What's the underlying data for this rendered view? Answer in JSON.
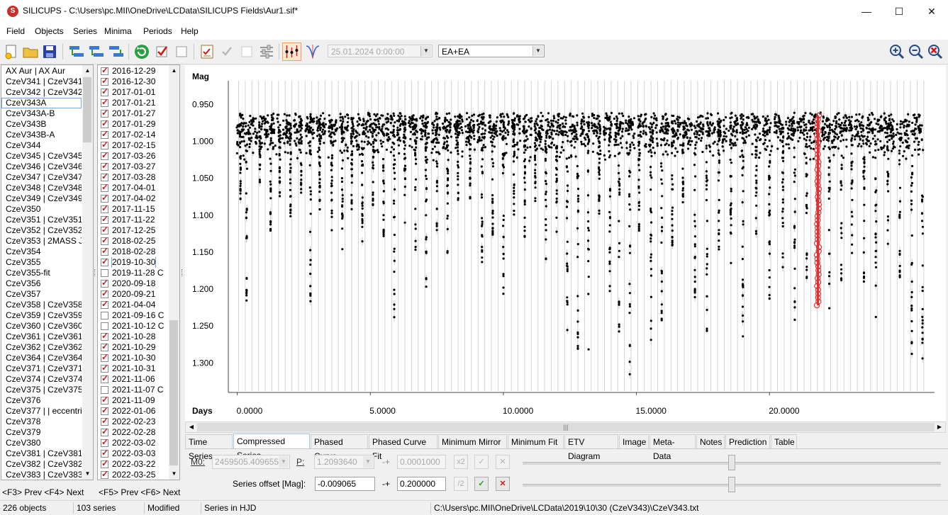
{
  "window": {
    "title": "SILICUPS - C:\\Users\\pc.MII\\OneDrive\\LCData\\SILICUPS Fields\\Aur1.sif*"
  },
  "menu": [
    "Field",
    "Objects",
    "Series",
    "Minima",
    "Periods",
    "Help"
  ],
  "toolbar": {
    "date_value": "25.01.2024   0:00:00",
    "filter_value": "EA+EA"
  },
  "objects": {
    "items": [
      "AX Aur | AX Aur",
      "CzeV341 | CzeV341",
      "CzeV342 | CzeV342",
      "CzeV343A",
      "CzeV343A-B",
      "CzeV343B",
      "CzeV343B-A",
      "CzeV344",
      "CzeV345 | CzeV345",
      "CzeV346 | CzeV346 |",
      "CzeV347 | CzeV347",
      "CzeV348 | CzeV348",
      "CzeV349 | CzeV349",
      "CzeV350",
      "CzeV351 | CzeV351",
      "CzeV352 | CzeV352",
      "CzeV353 | 2MASS J05",
      "CzeV354",
      "CzeV355",
      "CzeV355-fit",
      "CzeV356",
      "CzeV357",
      "CzeV358 | CzeV358",
      "CzeV359 | CzeV359",
      "CzeV360 | CzeV360",
      "CzeV361 | CzeV361",
      "CzeV362 | CzeV362",
      "CzeV364 | CzeV364 |",
      "CzeV371 | CzeV371",
      "CzeV374 | CzeV374",
      "CzeV375 | CzeV375",
      "CzeV376",
      "CzeV377 | | eccentric",
      "CzeV378",
      "CzeV379",
      "CzeV380",
      "CzeV381 | CzeV381",
      "CzeV382 | CzeV382",
      "CzeV383 | CzeV383"
    ],
    "nav": "<F3> Prev <F4> Next"
  },
  "series": {
    "items": [
      {
        "label": "2016-12-29",
        "checked": true
      },
      {
        "label": "2016-12-30",
        "checked": true
      },
      {
        "label": "2017-01-01",
        "checked": true
      },
      {
        "label": "2017-01-21",
        "checked": true
      },
      {
        "label": "2017-01-27",
        "checked": true
      },
      {
        "label": "2017-01-29",
        "checked": true
      },
      {
        "label": "2017-02-14",
        "checked": true
      },
      {
        "label": "2017-02-15",
        "checked": true
      },
      {
        "label": "2017-03-26",
        "checked": true
      },
      {
        "label": "2017-03-27",
        "checked": true
      },
      {
        "label": "2017-03-28",
        "checked": true
      },
      {
        "label": "2017-04-01",
        "checked": true
      },
      {
        "label": "2017-04-02",
        "checked": true
      },
      {
        "label": "2017-11-15",
        "checked": true
      },
      {
        "label": "2017-11-22",
        "checked": true
      },
      {
        "label": "2017-12-25",
        "checked": true
      },
      {
        "label": "2018-02-25",
        "checked": true
      },
      {
        "label": "2018-02-28",
        "checked": true
      },
      {
        "label": "2019-10-30",
        "checked": true
      },
      {
        "label": "2019-11-28 C",
        "checked": false
      },
      {
        "label": "2020-09-18",
        "checked": true
      },
      {
        "label": "2020-09-21",
        "checked": true
      },
      {
        "label": "2021-04-04",
        "checked": true
      },
      {
        "label": "2021-09-16 C",
        "checked": false
      },
      {
        "label": "2021-10-12 C",
        "checked": false
      },
      {
        "label": "2021-10-28",
        "checked": true
      },
      {
        "label": "2021-10-29",
        "checked": true
      },
      {
        "label": "2021-10-30",
        "checked": true
      },
      {
        "label": "2021-10-31",
        "checked": true
      },
      {
        "label": "2021-11-06",
        "checked": true
      },
      {
        "label": "2021-11-07 C",
        "checked": false
      },
      {
        "label": "2021-11-09",
        "checked": true
      },
      {
        "label": "2022-01-06",
        "checked": true
      },
      {
        "label": "2022-02-23",
        "checked": true
      },
      {
        "label": "2022-02-28",
        "checked": true
      },
      {
        "label": "2022-03-02",
        "checked": true
      },
      {
        "label": "2022-03-03",
        "checked": true
      },
      {
        "label": "2022-03-22",
        "checked": true
      },
      {
        "label": "2022-03-25",
        "checked": true
      }
    ],
    "nav": "<F5> Prev <F6> Next"
  },
  "chart_data": {
    "type": "scatter",
    "ylabel": "Mag",
    "xlabel": "Days",
    "x_ticks": [
      "0.0000",
      "5.0000",
      "10.0000",
      "15.0000",
      "20.0000"
    ],
    "y_ticks": [
      "0.950",
      "1.000",
      "1.050",
      "1.100",
      "1.150",
      "1.200",
      "1.250",
      "1.300"
    ],
    "xlim": [
      -0.15,
      26.15
    ],
    "ylim": [
      0.918,
      1.338
    ],
    "y_inverted": true,
    "baseline_mag": 0.975,
    "highlighted_series_x": 21.82,
    "highlight_color": "#e03030",
    "point_color": "#000000",
    "minima": [
      {
        "x": 0.12,
        "depth": 1.08
      },
      {
        "x": 0.35,
        "depth": 1.24
      },
      {
        "x": 0.85,
        "depth": 1.06
      },
      {
        "x": 1.25,
        "depth": 1.12
      },
      {
        "x": 1.6,
        "depth": 1.08
      },
      {
        "x": 2.0,
        "depth": 1.11
      },
      {
        "x": 2.4,
        "depth": 1.07
      },
      {
        "x": 2.75,
        "depth": 1.23
      },
      {
        "x": 3.1,
        "depth": 1.1
      },
      {
        "x": 3.55,
        "depth": 1.12
      },
      {
        "x": 3.95,
        "depth": 1.16
      },
      {
        "x": 4.3,
        "depth": 1.1
      },
      {
        "x": 4.7,
        "depth": 1.14
      },
      {
        "x": 5.1,
        "depth": 1.09
      },
      {
        "x": 5.5,
        "depth": 1.13
      },
      {
        "x": 5.9,
        "depth": 1.25
      },
      {
        "x": 6.3,
        "depth": 1.12
      },
      {
        "x": 6.7,
        "depth": 1.15
      },
      {
        "x": 7.1,
        "depth": 1.2
      },
      {
        "x": 7.5,
        "depth": 1.12
      },
      {
        "x": 7.9,
        "depth": 1.17
      },
      {
        "x": 8.3,
        "depth": 1.1
      },
      {
        "x": 8.75,
        "depth": 1.08
      },
      {
        "x": 9.2,
        "depth": 1.19
      },
      {
        "x": 9.6,
        "depth": 1.13
      },
      {
        "x": 10.0,
        "depth": 1.21
      },
      {
        "x": 10.4,
        "depth": 1.1
      },
      {
        "x": 10.8,
        "depth": 1.14
      },
      {
        "x": 11.2,
        "depth": 1.08
      },
      {
        "x": 11.6,
        "depth": 1.16
      },
      {
        "x": 12.0,
        "depth": 1.12
      },
      {
        "x": 12.4,
        "depth": 1.3
      },
      {
        "x": 12.8,
        "depth": 1.28
      },
      {
        "x": 13.2,
        "depth": 1.32
      },
      {
        "x": 13.6,
        "depth": 1.11
      },
      {
        "x": 14.0,
        "depth": 1.21
      },
      {
        "x": 14.35,
        "depth": 1.26
      },
      {
        "x": 14.75,
        "depth": 1.32
      },
      {
        "x": 15.1,
        "depth": 1.12
      },
      {
        "x": 15.55,
        "depth": 1.28
      },
      {
        "x": 15.95,
        "depth": 1.24
      },
      {
        "x": 16.35,
        "depth": 1.15
      },
      {
        "x": 16.75,
        "depth": 1.1
      },
      {
        "x": 17.2,
        "depth": 1.21
      },
      {
        "x": 17.65,
        "depth": 1.27
      },
      {
        "x": 18.1,
        "depth": 1.15
      },
      {
        "x": 18.55,
        "depth": 1.2
      },
      {
        "x": 19.0,
        "depth": 1.28
      },
      {
        "x": 19.5,
        "depth": 1.14
      },
      {
        "x": 20.0,
        "depth": 1.22
      },
      {
        "x": 20.5,
        "depth": 1.17
      },
      {
        "x": 20.95,
        "depth": 1.24
      },
      {
        "x": 21.4,
        "depth": 1.19
      },
      {
        "x": 21.82,
        "depth": 1.22
      },
      {
        "x": 22.25,
        "depth": 1.24
      },
      {
        "x": 22.7,
        "depth": 1.21
      },
      {
        "x": 23.1,
        "depth": 1.17
      },
      {
        "x": 23.55,
        "depth": 1.2
      },
      {
        "x": 24.0,
        "depth": 1.24
      },
      {
        "x": 24.45,
        "depth": 1.16
      },
      {
        "x": 24.9,
        "depth": 1.19
      },
      {
        "x": 25.35,
        "depth": 1.29
      },
      {
        "x": 25.75,
        "depth": 1.33
      }
    ]
  },
  "tabs": [
    "Time Series",
    "Compressed Series",
    "Phased Curve",
    "Phased Curve Fit",
    "Minimum Mirror",
    "Minimum Fit",
    "ETV Diagram",
    "Image",
    "Meta-Data",
    "Notes",
    "Prediction",
    "Table"
  ],
  "active_tab": 1,
  "controls": {
    "m0_label": "M0:",
    "m0_value": "2459505.4096552",
    "p_label": "P:",
    "p_value": "1.2093640",
    "pm1": "-+",
    "p_step": "0.0001000",
    "x2": "x2",
    "offset_label": "Series offset [Mag]:",
    "offset_value": "-0.009065",
    "pm2": "-+",
    "offset_step": "0.200000",
    "div2": "/2"
  },
  "status": {
    "objects": "226 objects",
    "series": "103 series",
    "state": "Modified",
    "time": "Series in HJD",
    "path": "C:\\Users\\pc.MII\\OneDrive\\LCData\\2019\\10\\30 (CzeV343)\\CzeV343.txt"
  }
}
